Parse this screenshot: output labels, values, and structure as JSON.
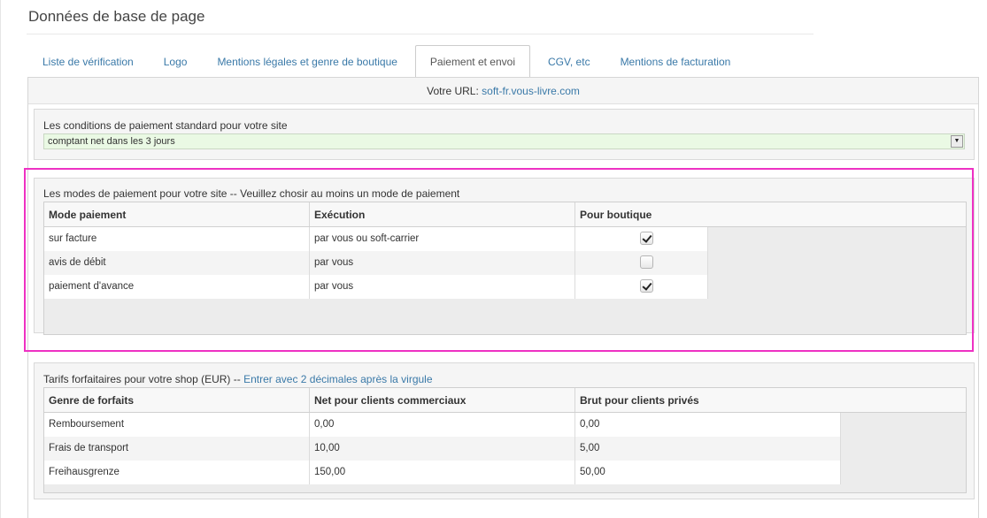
{
  "page_title": "Données de base de page",
  "tabs": [
    {
      "label": "Liste de vérification",
      "active": false
    },
    {
      "label": "Logo",
      "active": false
    },
    {
      "label": "Mentions légales et genre de boutique",
      "active": false
    },
    {
      "label": "Paiement et envoi",
      "active": true
    },
    {
      "label": "CGV, etc",
      "active": false
    },
    {
      "label": "Mentions de facturation",
      "active": false
    }
  ],
  "url_bar": {
    "prefix": "Votre URL:",
    "url": "soft-fr.vous-livre.com"
  },
  "payment_terms": {
    "label": "Les conditions de paiement standard pour votre site",
    "selected": "comptant net dans les 3 jours"
  },
  "payment_modes": {
    "label": "Les modes de paiement pour votre site -- Veuillez chosir au moins un mode de paiement",
    "headers": [
      "Mode paiement",
      "Exécution",
      "Pour boutique"
    ],
    "rows": [
      {
        "mode": "sur facture",
        "execution": "par vous ou soft-carrier",
        "checked": true
      },
      {
        "mode": "avis de débit",
        "execution": "par vous",
        "checked": false
      },
      {
        "mode": "paiement d'avance",
        "execution": "par vous",
        "checked": true
      }
    ]
  },
  "flat_rates": {
    "label": "Tarifs forfaitaires pour votre shop (EUR) --",
    "hint": "Entrer avec 2 décimales après la virgule",
    "headers": [
      "Genre de forfaits",
      "Net pour clients commerciaux",
      "Brut pour clients privés"
    ],
    "rows": [
      {
        "kind": "Remboursement",
        "net": "0,00",
        "gross": "0,00"
      },
      {
        "kind": "Frais de transport",
        "net": "10,00",
        "gross": "5,00"
      },
      {
        "kind": "Freihausgrenze",
        "net": "150,00",
        "gross": "50,00"
      }
    ]
  },
  "colors": {
    "link": "#3a79a8",
    "highlight": "#ee31c3",
    "select_bg": "#eaf9e4"
  }
}
